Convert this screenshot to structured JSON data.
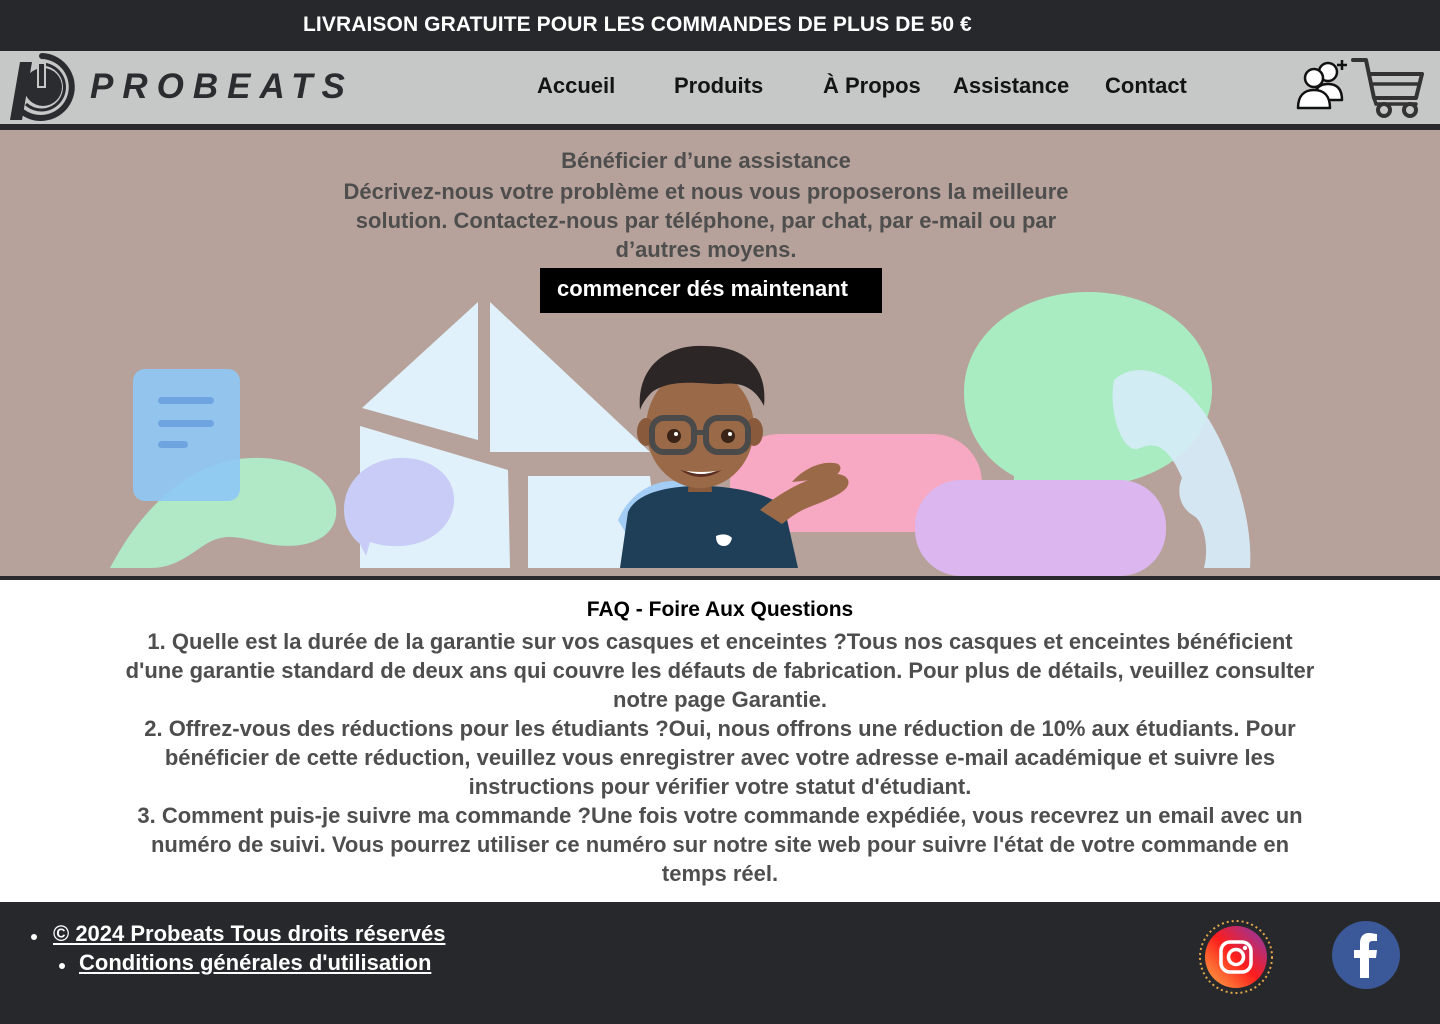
{
  "announcement": {
    "text": "LIVRAISON GRATUITE POUR LES COMMANDES DE PLUS DE 50 €"
  },
  "header": {
    "brand": "PROBEATS",
    "logo_icon": "probeats-logo-icon",
    "nav": [
      {
        "label": "Accueil"
      },
      {
        "label": "Produits"
      },
      {
        "label": "À Propos"
      },
      {
        "label": "Assistance"
      },
      {
        "label": "Contact"
      }
    ],
    "icons": {
      "account": "add-user-icon",
      "cart": "cart-icon"
    }
  },
  "hero": {
    "title": "Bénéficier d’une assistance",
    "description": "Décrivez-nous votre problème et nous vous proposerons la meilleure solution. Contactez-nous par téléphone, par chat, par e-mail ou par d’autres moyens.",
    "cta_label": "commencer dés maintenant",
    "illustration": "support-illustration-memoji"
  },
  "faq": {
    "title": "FAQ - Foire Aux Questions",
    "items": [
      {
        "question": "1. Quelle est la durée de la garantie sur vos casques et enceintes ?",
        "answer": "Tous nos casques et enceintes bénéficient d'une garantie standard de deux ans qui couvre les défauts de fabrication. Pour plus de détails, veuillez consulter notre page Garantie."
      },
      {
        "question": "2. Offrez-vous des réductions pour les étudiants ?",
        "answer": "Oui, nous offrons une réduction de 10% aux étudiants. Pour bénéficier de cette réduction, veuillez vous enregistrer avec votre adresse e-mail académique et suivre les instructions pour vérifier votre statut d'étudiant."
      },
      {
        "question": "3. Comment puis-je suivre ma commande ?",
        "answer": "Une fois votre commande expédiée, vous recevrez un email avec un numéro de suivi. Vous pourrez utiliser ce numéro sur notre site web pour suivre l'état de votre commande en temps réel."
      }
    ]
  },
  "footer": {
    "copyright": "© 2024  Probeats Tous droits réservés",
    "terms": "Conditions générales d'utilisation",
    "social": {
      "instagram": "instagram-icon",
      "facebook": "facebook-icon"
    }
  },
  "colors": {
    "dark": "#27282c",
    "nav_bg": "#c6c8c7",
    "hero_bg": "#b6a29a",
    "body_text": "#4f4e4e",
    "facebook_blue": "#3b5998"
  }
}
